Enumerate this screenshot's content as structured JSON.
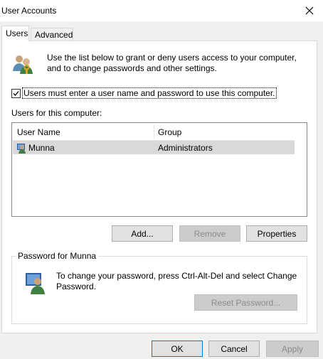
{
  "window": {
    "title": "User Accounts"
  },
  "tabs": [
    {
      "label": "Users",
      "active": true
    },
    {
      "label": "Advanced",
      "active": false
    }
  ],
  "intro_text": "Use the list below to grant or deny users access to your computer, and to change passwords and other settings.",
  "checkbox": {
    "label": "Users must enter a user name and password to use this computer.",
    "checked": true
  },
  "users_section_label": "Users for this computer:",
  "users_table": {
    "columns": [
      "User Name",
      "Group"
    ],
    "rows": [
      {
        "name": "Munna",
        "group": "Administrators",
        "selected": true
      }
    ]
  },
  "buttons": {
    "add": "Add...",
    "remove": "Remove",
    "properties": "Properties",
    "reset_password": "Reset Password...",
    "ok": "OK",
    "cancel": "Cancel",
    "apply": "Apply"
  },
  "password_group": {
    "title": "Password for Munna",
    "text": "To change your password, press Ctrl-Alt-Del and select Change Password."
  },
  "icons": {
    "close": "close-icon",
    "users": "users-icon",
    "user_row": "user-icon",
    "password": "user-key-icon"
  },
  "colors": {
    "selection": "#d9d9d9",
    "default_button_border": "#0078d7"
  }
}
